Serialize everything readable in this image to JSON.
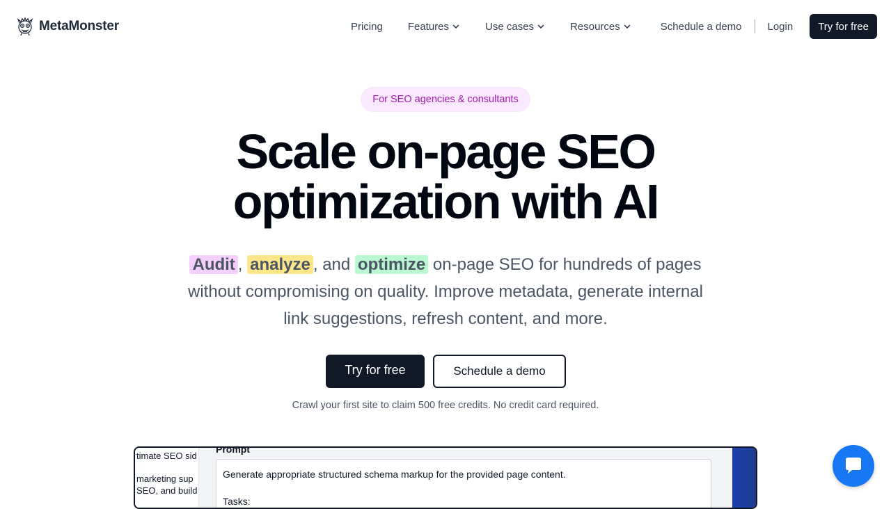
{
  "brand": {
    "name": "MetaMonster",
    "logo_icon": "monster-logo-icon"
  },
  "nav": {
    "pricing": "Pricing",
    "features": "Features",
    "use_cases": "Use cases",
    "resources": "Resources",
    "schedule_demo": "Schedule a demo",
    "login": "Login",
    "try_free": "Try for free",
    "dropdown_icon": "chevron-down-icon"
  },
  "hero": {
    "badge": "For SEO agencies & consultants",
    "title_line1": "Scale on-page SEO",
    "title_line2": "optimization with AI",
    "subtitle": {
      "word_audit": "Audit",
      "sep1": ", ",
      "word_analyze": "analyze",
      "sep2": ", and ",
      "word_optimize": "optimize",
      "rest": " on-page SEO for hundreds of pages without compromising on quality. Improve metadata, generate internal link suggestions, refresh content, and more."
    },
    "cta_primary": "Try for free",
    "cta_secondary": "Schedule a demo",
    "fineprint": "Crawl your first site to claim 500 free credits. No credit card required."
  },
  "preview": {
    "left_line1": "timate SEO sid",
    "left_line2": "marketing sup",
    "left_line3": " SEO, and build",
    "prompt_label": "Prompt",
    "prompt_text": "Generate appropriate structured schema markup for the provided page content.",
    "prompt_line2": "Tasks:"
  },
  "chat": {
    "icon": "chat-bubble-icon"
  },
  "colors": {
    "primary_dark": "#111827",
    "badge_bg": "#fae8ff",
    "badge_text": "#a21caf",
    "highlight_audit": "#f5d0fe",
    "highlight_analyze": "#fde68a",
    "highlight_optimize": "#bbf7d0",
    "chat_blue": "#1877f2"
  }
}
